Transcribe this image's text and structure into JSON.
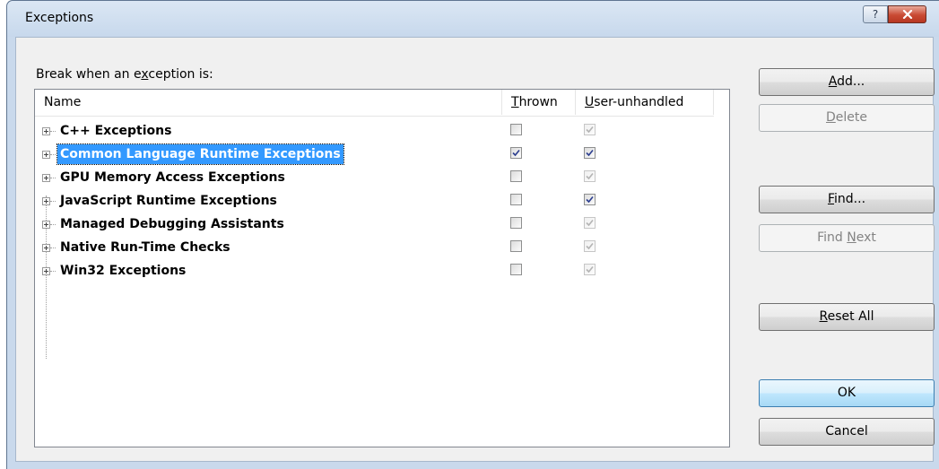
{
  "window": {
    "title": "Exceptions",
    "help_glyph": "?"
  },
  "break_label": {
    "pre": "Break when an e",
    "accel": "x",
    "post": "ception is:"
  },
  "columns": {
    "name": "Name",
    "thrown": {
      "accel": "T",
      "rest": "hrown"
    },
    "user_unhandled": {
      "accel": "U",
      "rest": "ser-unhandled"
    }
  },
  "rows": [
    {
      "label": "C++ Exceptions",
      "thrown": false,
      "user_unhandled": true,
      "user_enabled": false,
      "selected": false
    },
    {
      "label": "Common Language Runtime Exceptions",
      "thrown": true,
      "user_unhandled": true,
      "user_enabled": true,
      "selected": true
    },
    {
      "label": "GPU Memory Access Exceptions",
      "thrown": false,
      "user_unhandled": true,
      "user_enabled": false,
      "selected": false
    },
    {
      "label": "JavaScript Runtime Exceptions",
      "thrown": false,
      "user_unhandled": true,
      "user_enabled": true,
      "selected": false
    },
    {
      "label": "Managed Debugging Assistants",
      "thrown": false,
      "user_unhandled": true,
      "user_enabled": false,
      "selected": false
    },
    {
      "label": "Native Run-Time Checks",
      "thrown": false,
      "user_unhandled": true,
      "user_enabled": false,
      "selected": false
    },
    {
      "label": "Win32 Exceptions",
      "thrown": false,
      "user_unhandled": true,
      "user_enabled": false,
      "selected": false
    }
  ],
  "buttons": {
    "add": {
      "accel": "A",
      "rest": "dd...",
      "enabled": true
    },
    "delete": {
      "accel": "D",
      "rest": "elete",
      "enabled": false
    },
    "find": {
      "accel": "F",
      "rest": "ind...",
      "enabled": true
    },
    "find_next": {
      "pre": "Find ",
      "accel": "N",
      "rest": "ext",
      "enabled": false
    },
    "reset_all": {
      "accel": "R",
      "rest": "eset All",
      "enabled": true
    },
    "ok": {
      "label": "OK",
      "enabled": true
    },
    "cancel": {
      "label": "Cancel",
      "enabled": true
    }
  },
  "icons": {
    "help": "help-icon",
    "close": "close-icon",
    "expander": "plus-expander-icon",
    "checkbox": "checkmark-icon"
  }
}
